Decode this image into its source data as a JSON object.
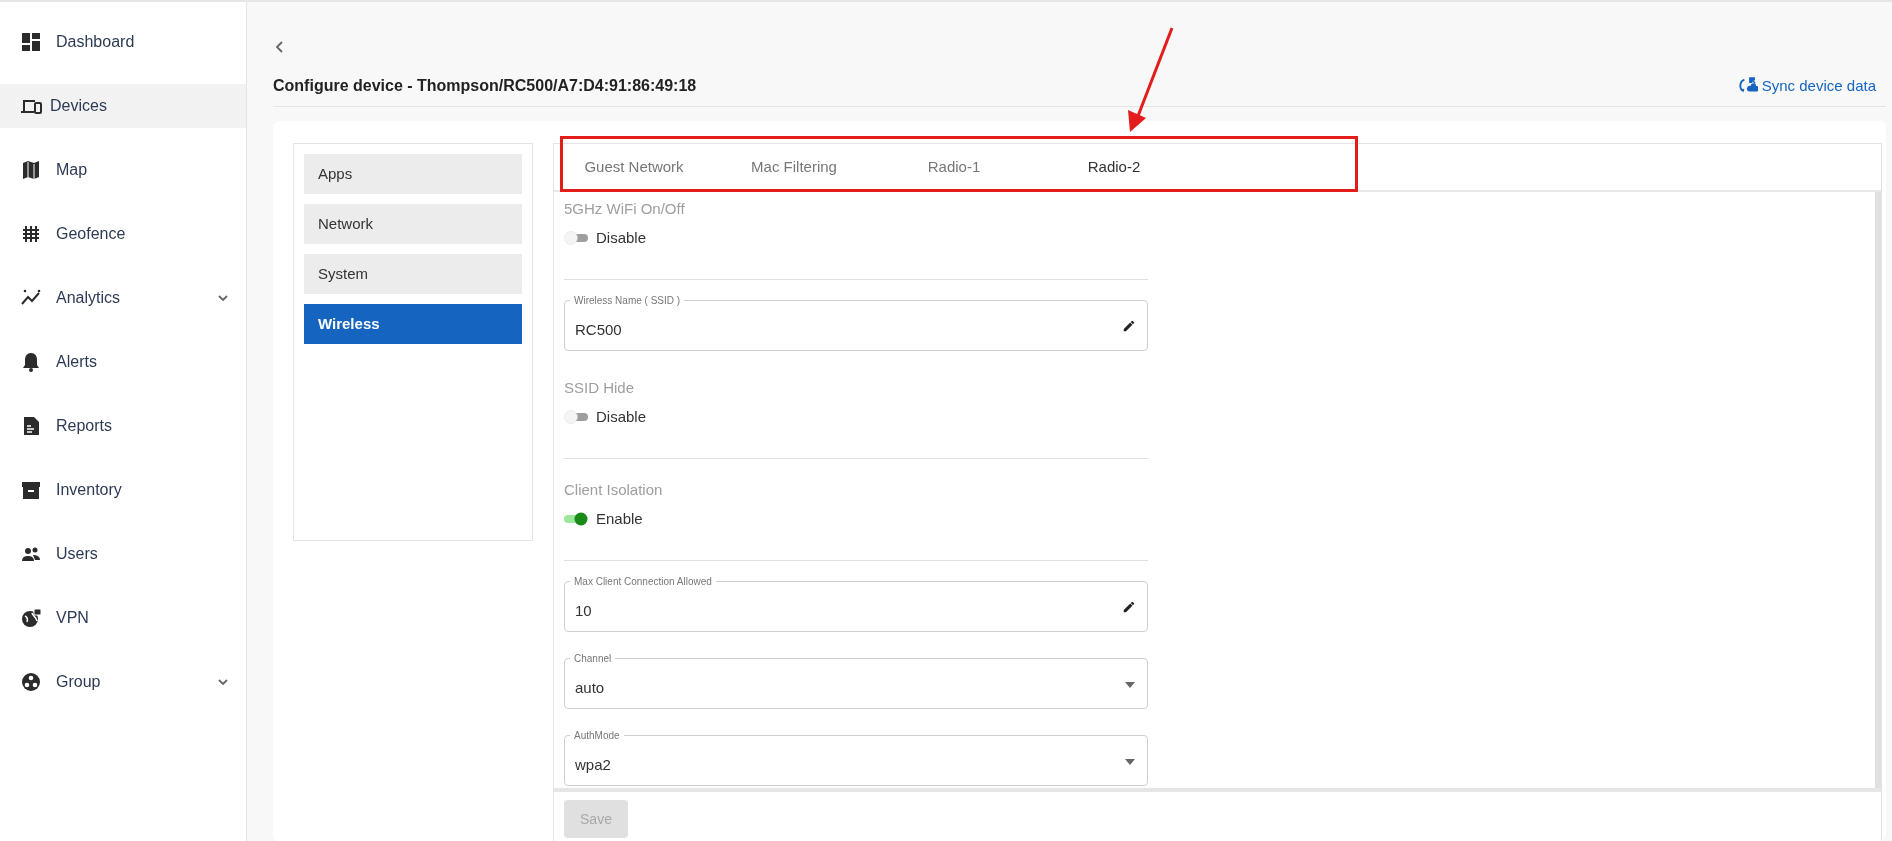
{
  "sidebar": {
    "items": [
      {
        "label": "Dashboard",
        "selected": false,
        "expandable": false
      },
      {
        "label": "Devices",
        "selected": true,
        "expandable": false
      },
      {
        "label": "Map",
        "selected": false,
        "expandable": false
      },
      {
        "label": "Geofence",
        "selected": false,
        "expandable": false
      },
      {
        "label": "Analytics",
        "selected": false,
        "expandable": true
      },
      {
        "label": "Alerts",
        "selected": false,
        "expandable": false
      },
      {
        "label": "Reports",
        "selected": false,
        "expandable": false
      },
      {
        "label": "Inventory",
        "selected": false,
        "expandable": false
      },
      {
        "label": "Users",
        "selected": false,
        "expandable": false
      },
      {
        "label": "VPN",
        "selected": false,
        "expandable": false
      },
      {
        "label": "Group",
        "selected": false,
        "expandable": true
      }
    ]
  },
  "page": {
    "title": "Configure device - Thompson/RC500/A7:D4:91:86:49:18",
    "sync_link": "Sync device data"
  },
  "config_menu": [
    {
      "label": "Apps",
      "selected": false
    },
    {
      "label": "Network",
      "selected": false
    },
    {
      "label": "System",
      "selected": false
    },
    {
      "label": "Wireless",
      "selected": true
    }
  ],
  "tabs": [
    {
      "label": "Guest Network",
      "selected": false
    },
    {
      "label": "Mac Filtering",
      "selected": false
    },
    {
      "label": "Radio-1",
      "selected": false
    },
    {
      "label": "Radio-2",
      "selected": true
    }
  ],
  "settings": [
    {
      "kind": "toggle",
      "label": "5GHz WiFi On/Off",
      "on": false,
      "state_text": "Disable"
    },
    {
      "kind": "text",
      "label": "Wireless Name ( SSID )",
      "value": "RC500"
    },
    {
      "kind": "toggle",
      "label": "SSID Hide",
      "on": false,
      "state_text": "Disable"
    },
    {
      "kind": "toggle",
      "label": "Client Isolation",
      "on": true,
      "state_text": "Enable"
    },
    {
      "kind": "text",
      "label": "Max Client Connection Allowed",
      "value": "10"
    },
    {
      "kind": "select",
      "label": "Channel",
      "value": "auto"
    },
    {
      "kind": "select",
      "label": "AuthMode",
      "value": "wpa2"
    }
  ],
  "save_button": {
    "label": "Save",
    "disabled": true
  }
}
